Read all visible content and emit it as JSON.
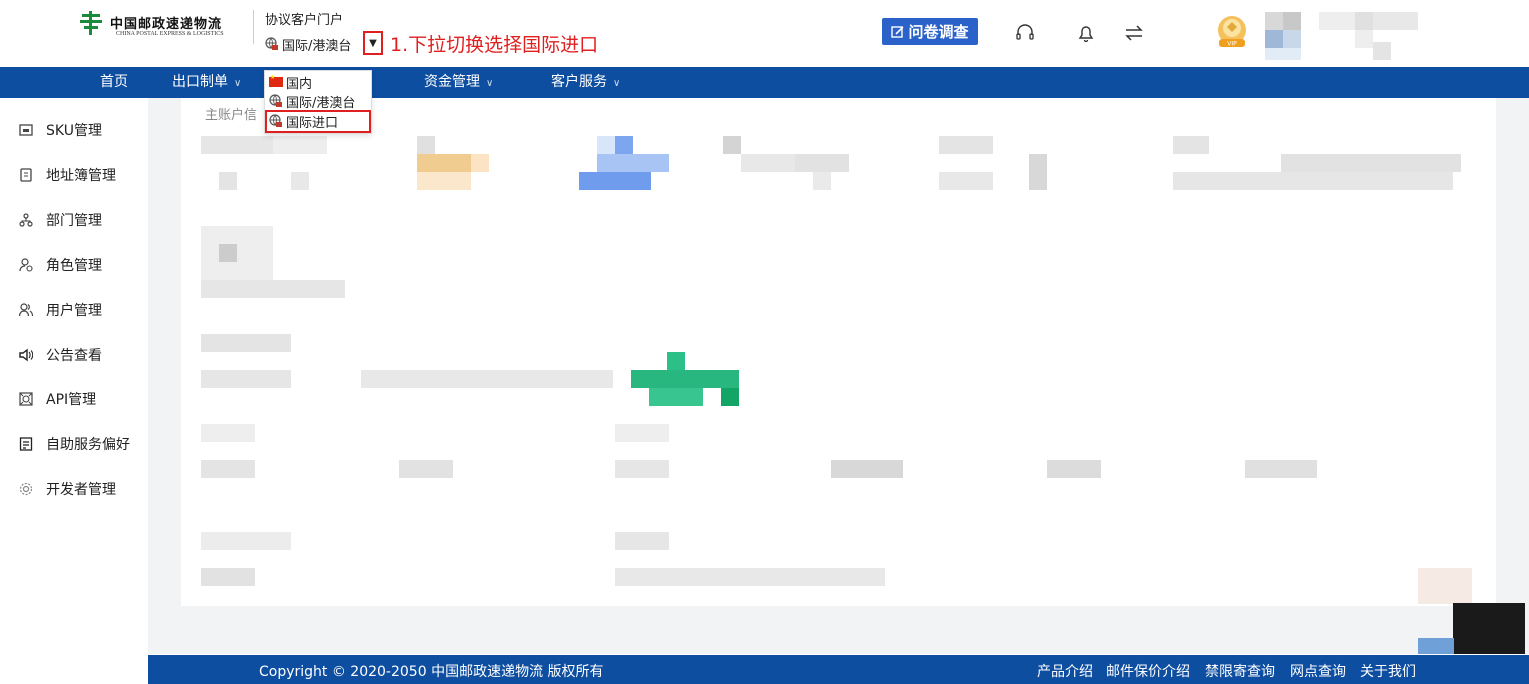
{
  "header": {
    "logo": {
      "cn": "中国邮政速递物流",
      "en": "CHINA POSTAL EXPRESS & LOGISTICS",
      "brand_color": "#1a8a3c"
    },
    "portal_title": "协议客户门户",
    "region_selected": "国际/港澳台",
    "annotation": "1.下拉切换选择国际进口",
    "annotation_color": "#e02020",
    "survey_label": "问卷调查",
    "icons": [
      "headset-icon",
      "bell-icon",
      "swap-icon"
    ]
  },
  "region_dropdown": {
    "options": [
      {
        "label": "国内",
        "icon": "china-flag-icon"
      },
      {
        "label": "国际/港澳台",
        "icon": "globe-icon"
      },
      {
        "label": "国际进口",
        "icon": "globe-icon",
        "highlighted": true
      }
    ]
  },
  "nav": {
    "bg_color": "#0d4ea1",
    "items": [
      {
        "label": "首页",
        "has_dropdown": false
      },
      {
        "label": "出口制单",
        "has_dropdown": true
      },
      {
        "label": "资金管理",
        "has_dropdown": true
      },
      {
        "label": "客户服务",
        "has_dropdown": true
      }
    ]
  },
  "sidebar": {
    "items": [
      {
        "label": "SKU管理",
        "icon": "sku-icon"
      },
      {
        "label": "地址簿管理",
        "icon": "address-book-icon"
      },
      {
        "label": "部门管理",
        "icon": "org-icon"
      },
      {
        "label": "角色管理",
        "icon": "role-icon"
      },
      {
        "label": "用户管理",
        "icon": "user-icon"
      },
      {
        "label": "公告查看",
        "icon": "speaker-icon"
      },
      {
        "label": "API管理",
        "icon": "api-icon"
      },
      {
        "label": "自助服务偏好",
        "icon": "preference-icon"
      },
      {
        "label": "开发者管理",
        "icon": "developer-icon"
      }
    ]
  },
  "main": {
    "section_label": "主账户信"
  },
  "footer": {
    "copyright": "Copyright © 2020-2050 中国邮政速递物流 版权所有",
    "links": [
      "产品介绍",
      "邮件保价介绍",
      "禁限寄查询",
      "网点查询",
      "关于我们"
    ]
  }
}
